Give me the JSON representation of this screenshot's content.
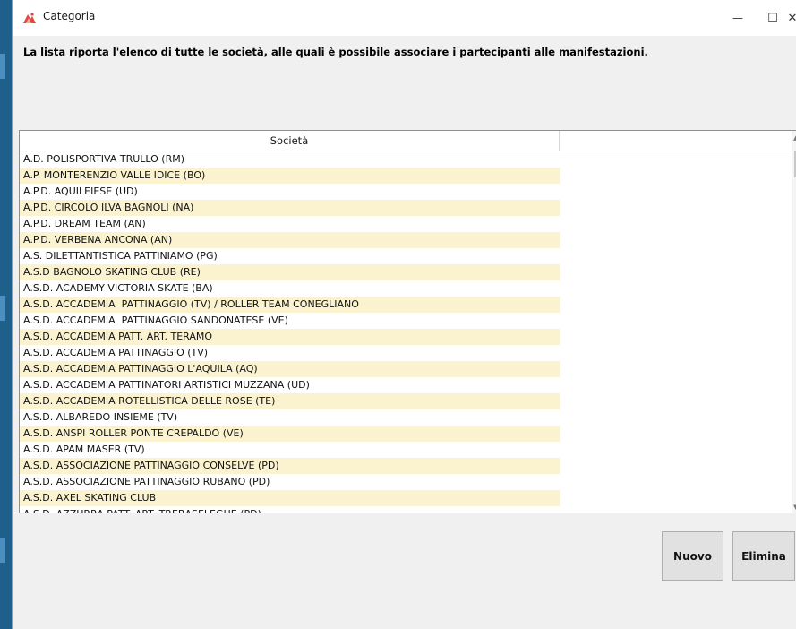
{
  "window": {
    "title": "Categoria",
    "controls": {
      "minimize": "—",
      "maximize": "☐",
      "close": "✕"
    }
  },
  "description": "La lista riporta l'elenco di tutte le società, alle quali è possibile associare i partecipanti alle manifestazioni.",
  "table": {
    "column_header": "Società",
    "rows": [
      "A.D. POLISPORTIVA TRULLO (RM)",
      "A.P. MONTERENZIO VALLE IDICE (BO)",
      "A.P.D. AQUILEIESE (UD)",
      "A.P.D. CIRCOLO ILVA BAGNOLI (NA)",
      "A.P.D. DREAM TEAM (AN)",
      "A.P.D. VERBENA ANCONA (AN)",
      "A.S. DILETTANTISTICA PATTINIAMO (PG)",
      "A.S.D BAGNOLO SKATING CLUB (RE)",
      "A.S.D. ACADEMY VICTORIA SKATE (BA)",
      "A.S.D. ACCADEMIA  PATTINAGGIO (TV) / ROLLER TEAM CONEGLIANO",
      "A.S.D. ACCADEMIA  PATTINAGGIO SANDONATESE (VE)",
      "A.S.D. ACCADEMIA PATT. ART. TERAMO",
      "A.S.D. ACCADEMIA PATTINAGGIO (TV)",
      "A.S.D. ACCADEMIA PATTINAGGIO L'AQUILA (AQ)",
      "A.S.D. ACCADEMIA PATTINATORI ARTISTICI MUZZANA (UD)",
      "A.S.D. ACCADEMIA ROTELLISTICA DELLE ROSE (TE)",
      "A.S.D. ALBAREDO INSIEME (TV)",
      "A.S.D. ANSPI ROLLER PONTE CREPALDO (VE)",
      "A.S.D. APAM MASER (TV)",
      "A.S.D. ASSOCIAZIONE PATTINAGGIO CONSELVE (PD)",
      "A.S.D. ASSOCIAZIONE PATTINAGGIO RUBANO (PD)",
      "A.S.D. AXEL SKATING CLUB",
      "A.S.D. AZZURRA PATT. ART. TREBASELEGHE (PD)"
    ]
  },
  "buttons": {
    "new": "Nuovo",
    "delete": "Elimina"
  },
  "colors": {
    "row_alt": "#fbf3d0",
    "window_bg": "#f0f0f0"
  }
}
